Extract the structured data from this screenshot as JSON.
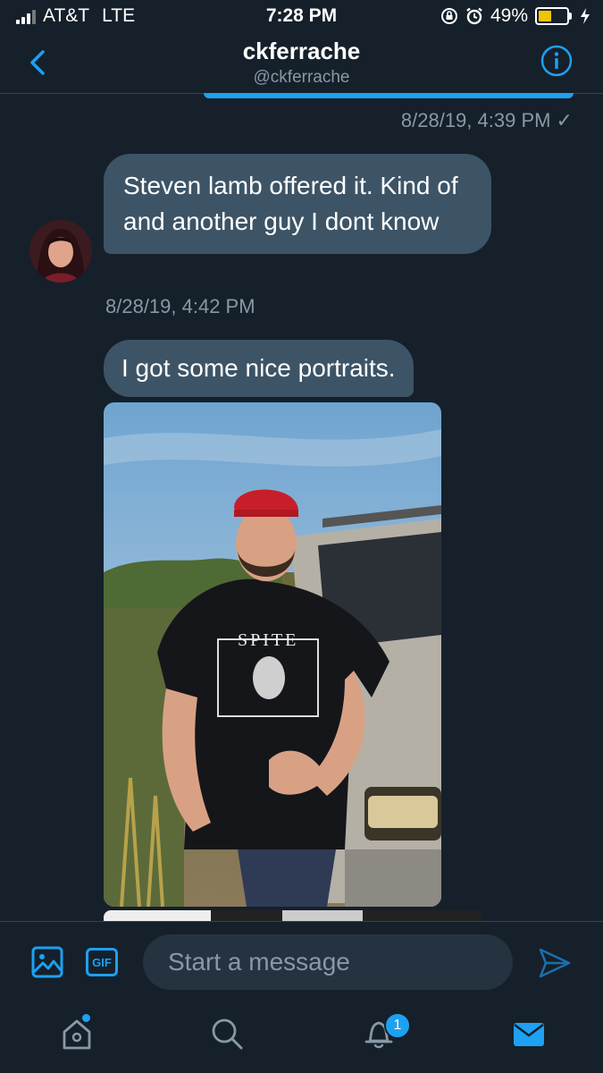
{
  "status_bar": {
    "carrier": "AT&T",
    "network": "LTE",
    "time": "7:28 PM",
    "battery_percent": "49%",
    "battery_level": 0.49,
    "icons": [
      "signal-icon",
      "rotation-lock-icon",
      "alarm-icon",
      "battery-icon",
      "charging-icon"
    ]
  },
  "header": {
    "name": "ckferrache",
    "handle": "@ckferrache",
    "back_icon": "chevron-left-icon",
    "info_icon": "info-icon"
  },
  "conversation": {
    "sent_timestamp": "8/28/19, 4:39 PM ✓",
    "messages": [
      {
        "text": "Steven lamb offered it. Kind of and another guy I dont know"
      },
      {
        "timestamp": "8/28/19, 4:42 PM"
      },
      {
        "text": "I got some nice portraits."
      }
    ],
    "photo": {
      "shirt_text": "SPITE"
    }
  },
  "composer": {
    "gif_label": "GIF",
    "placeholder": "Start a message"
  },
  "tab_bar": {
    "notification_count": "1",
    "icons": [
      "home-icon",
      "search-icon",
      "notifications-icon",
      "messages-icon"
    ]
  },
  "colors": {
    "background": "#15202b",
    "accent": "#1da1f2",
    "bubble": "#3d5466",
    "muted": "#8899a6"
  }
}
